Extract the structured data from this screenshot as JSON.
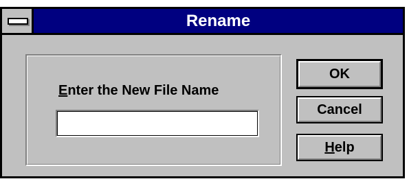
{
  "window": {
    "title": "Rename"
  },
  "form": {
    "label_mnemonic": "E",
    "label_rest": "nter the New File Name",
    "input_value": ""
  },
  "buttons": {
    "ok_label": "OK",
    "cancel_label": "Cancel",
    "help_mnemonic": "H",
    "help_rest": "elp"
  },
  "icons": {
    "system_menu": "system-menu-dash-icon"
  },
  "colors": {
    "titlebar": "#000080",
    "face": "#c0c0c0",
    "title_text": "#ffffff"
  }
}
